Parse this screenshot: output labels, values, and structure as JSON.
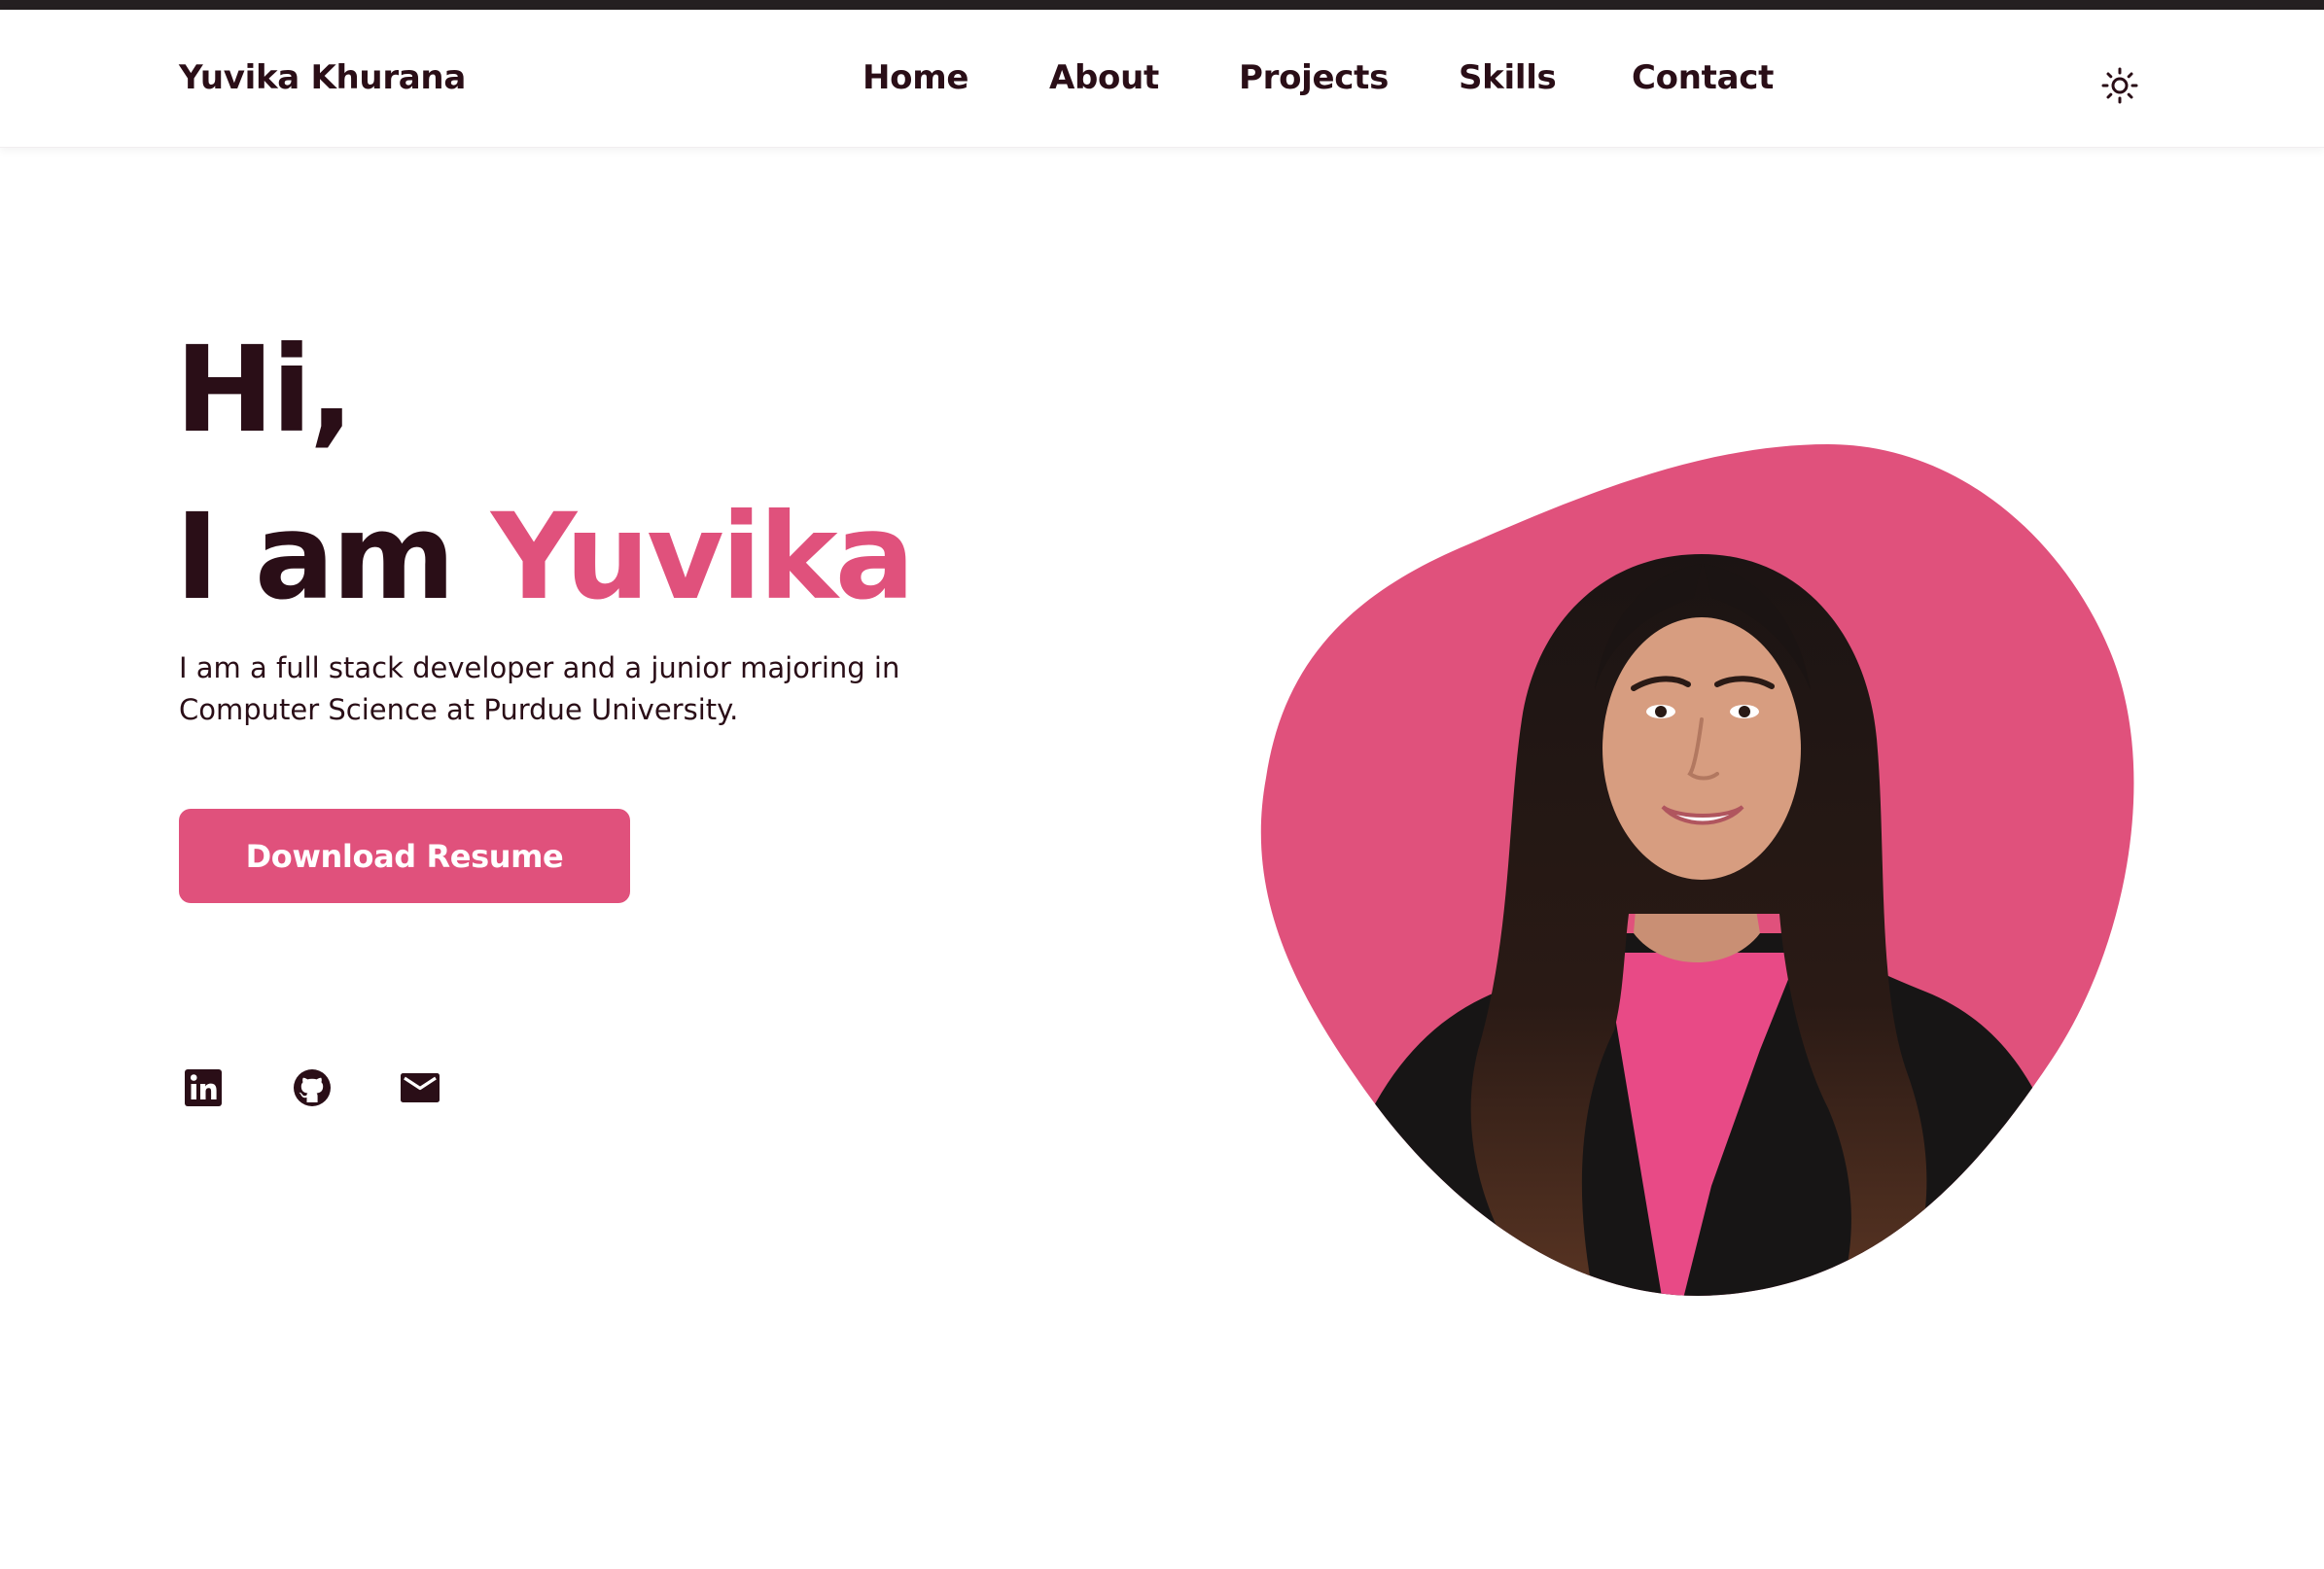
{
  "brand": {
    "name": "Yuvika Khurana"
  },
  "nav": {
    "links": [
      "Home",
      "About",
      "Projects",
      "Skills",
      "Contact"
    ],
    "theme_icon": "sun-icon"
  },
  "hero": {
    "greeting": "Hi,",
    "intro_prefix": "I am",
    "intro_name": "Yuvika",
    "description": "I am a full stack developer and a junior majoring in Computer Science at Purdue University.",
    "resume_button": "Download Resume"
  },
  "social": {
    "icons": [
      "linkedin-icon",
      "github-icon",
      "email-icon"
    ]
  },
  "colors": {
    "accent": "#e0517c",
    "text": "#2a0e17",
    "topbar": "#241f21"
  }
}
